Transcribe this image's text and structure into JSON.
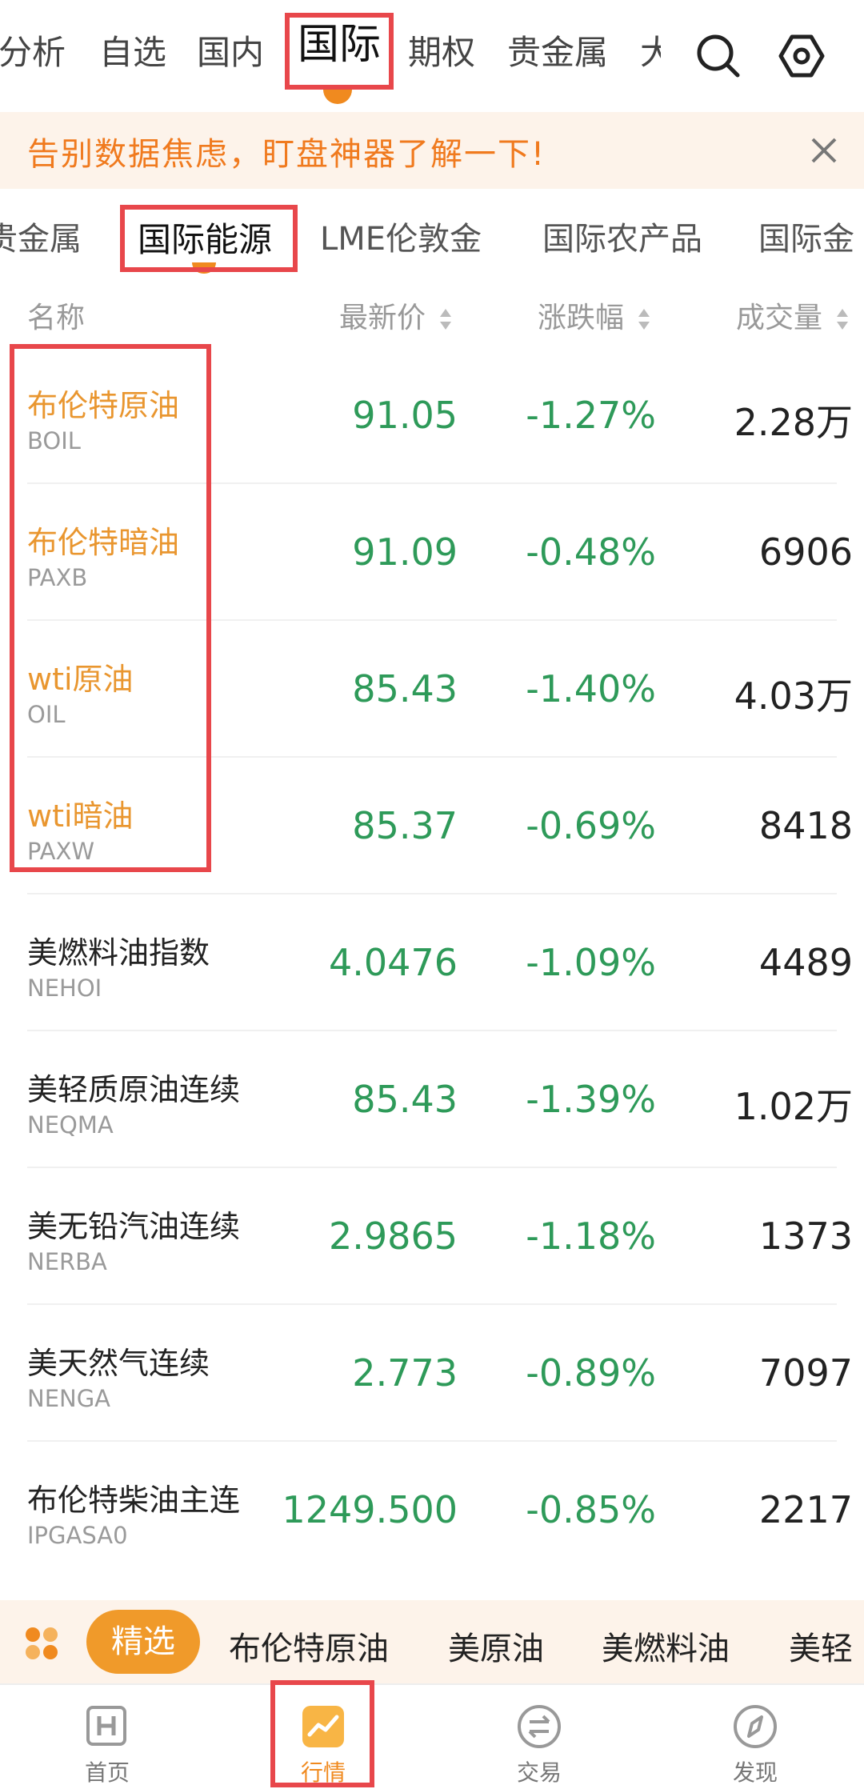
{
  "top_tabs": [
    "分析",
    "自选",
    "国内",
    "国际",
    "期权",
    "贵金属",
    "大"
  ],
  "active_top_tab": "国际",
  "banner": {
    "text": "告别数据焦虑，盯盘神器了解一下!"
  },
  "sub_tabs": [
    "贵金属",
    "国际能源",
    "LME伦敦金",
    "国际农产品",
    "国际金"
  ],
  "active_sub_tab": "国际能源",
  "columns": {
    "name": "名称",
    "price": "最新价",
    "change": "涨跌幅",
    "volume": "成交量"
  },
  "rows": [
    {
      "name": "布伦特原油",
      "code": "BOIL",
      "price": "91.05",
      "change": "-1.27%",
      "volume": "2.28万"
    },
    {
      "name": "布伦特暗油",
      "code": "PAXB",
      "price": "91.09",
      "change": "-0.48%",
      "volume": "6906"
    },
    {
      "name": "wti原油",
      "code": "OIL",
      "price": "85.43",
      "change": "-1.40%",
      "volume": "4.03万"
    },
    {
      "name": "wti暗油",
      "code": "PAXW",
      "price": "85.37",
      "change": "-0.69%",
      "volume": "8418"
    },
    {
      "name": "美燃料油指数",
      "code": "NEHOI",
      "price": "4.0476",
      "change": "-1.09%",
      "volume": "4489"
    },
    {
      "name": "美轻质原油连续",
      "code": "NEQMA",
      "price": "85.43",
      "change": "-1.39%",
      "volume": "1.02万"
    },
    {
      "name": "美无铅汽油连续",
      "code": "NERBA",
      "price": "2.9865",
      "change": "-1.18%",
      "volume": "1373"
    },
    {
      "name": "美天然气连续",
      "code": "NENGA",
      "price": "2.773",
      "change": "-0.89%",
      "volume": "7097"
    },
    {
      "name": "布伦特柴油主连",
      "code": "IPGASA0",
      "price": "1249.500",
      "change": "-0.85%",
      "volume": "2217"
    }
  ],
  "quick_bar": {
    "active": "精选",
    "items": [
      "布伦特原油",
      "美原油",
      "美燃料油",
      "美轻"
    ]
  },
  "bottom_nav": [
    {
      "label": "首页",
      "icon": "home-h-icon"
    },
    {
      "label": "行情",
      "icon": "market-chart-icon"
    },
    {
      "label": "交易",
      "icon": "trade-exchange-icon"
    },
    {
      "label": "发现",
      "icon": "compass-icon"
    }
  ],
  "colors": {
    "accent": "#f08a1f",
    "down": "#2e9a59",
    "highlight": "#e8474b",
    "orange_text": "#e9962f"
  }
}
